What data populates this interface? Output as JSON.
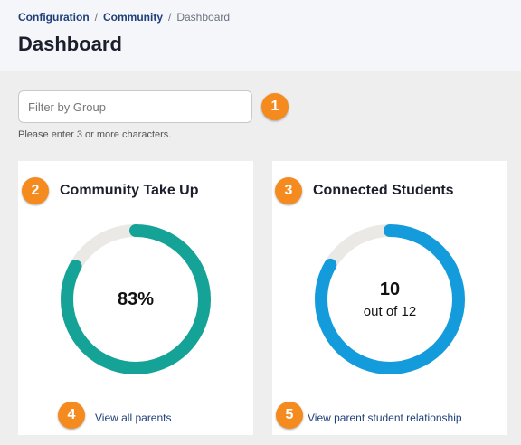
{
  "breadcrumb": {
    "item1": "Configuration",
    "item2": "Community",
    "current": "Dashboard",
    "separator": "/"
  },
  "page_title": "Dashboard",
  "filter": {
    "placeholder": "Filter by Group",
    "value": "",
    "helper": "Please enter 3 or more characters."
  },
  "cards": {
    "takeup": {
      "title": "Community Take Up",
      "value_text": "83%",
      "percent": 83,
      "color": "#14a396",
      "link": "View all parents"
    },
    "connected": {
      "title": "Connected Students",
      "value_text": "10",
      "sub_text": "out of 12",
      "connected": 10,
      "total": 12,
      "color": "#149bdb",
      "link": "View parent student relationship"
    }
  },
  "track_color": "#ebe9e6",
  "callouts": [
    "1",
    "2",
    "3",
    "4",
    "5"
  ],
  "callout_color": "#f58a1f"
}
